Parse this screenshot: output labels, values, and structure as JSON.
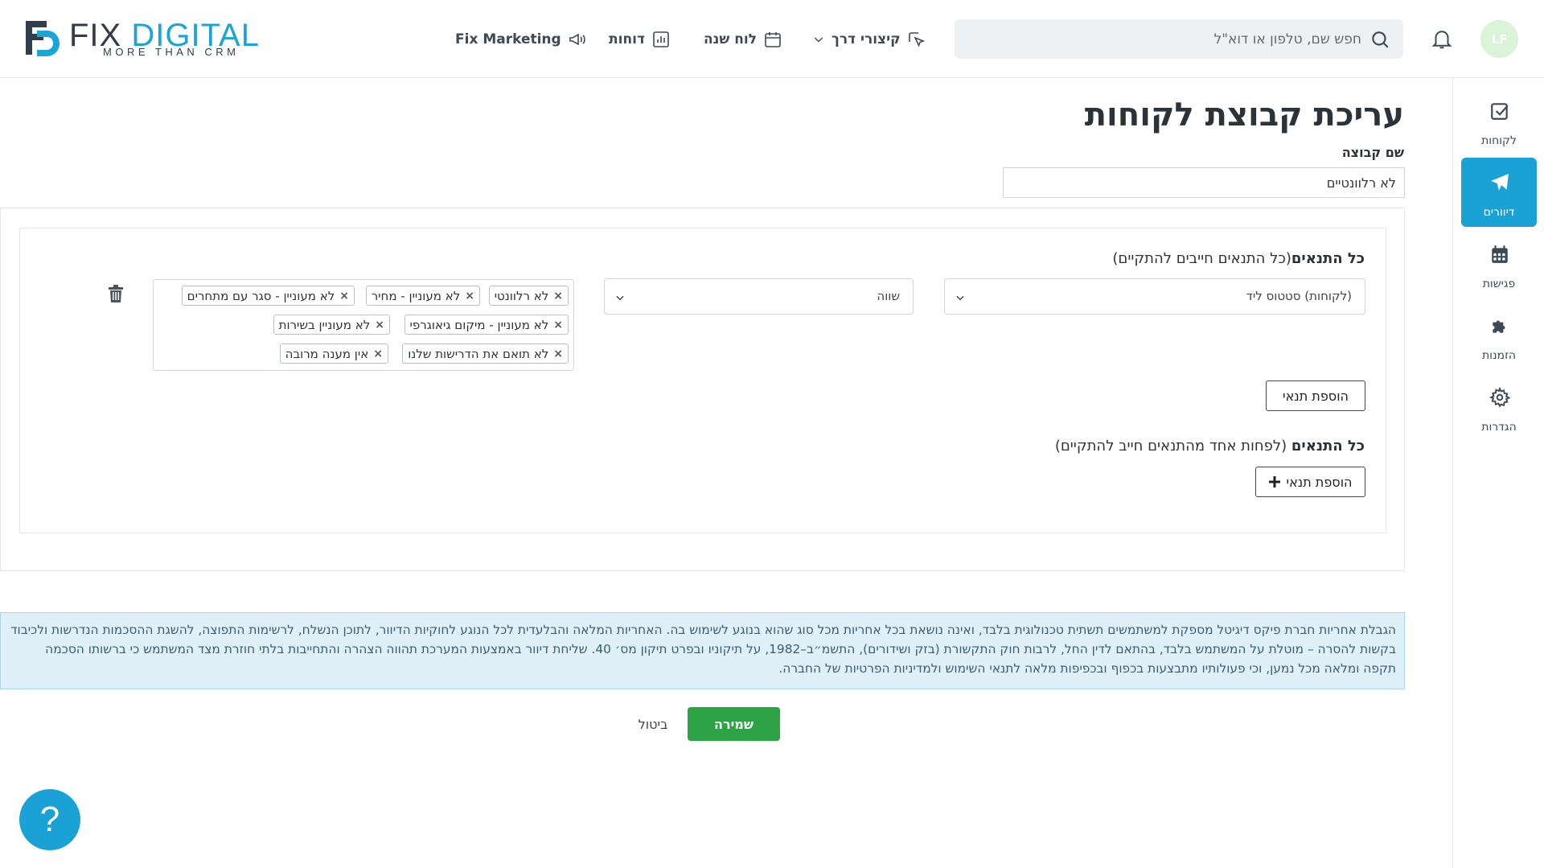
{
  "header": {
    "logo": {
      "fix": "FIX",
      "digital": "DIGITAL",
      "tagline": "MORE THAN CRM"
    },
    "nav": {
      "shortcuts": "קיצורי דרך",
      "calendar": "לוח שנה",
      "reports": "דוחות",
      "marketing": "Fix Marketing"
    },
    "search": {
      "placeholder": "חפש שם, טלפון או דוא\"ל",
      "value": ""
    },
    "avatar": "LF"
  },
  "sidebar": {
    "items": [
      {
        "label": "לקוחות",
        "icon": "check-square-icon"
      },
      {
        "label": "דיוורים",
        "icon": "paper-plane-icon",
        "active": true
      },
      {
        "label": "פגישות",
        "icon": "calendar-icon"
      },
      {
        "label": "הזמנות",
        "icon": "puzzle-icon"
      },
      {
        "label": "הגדרות",
        "icon": "gear-icon"
      }
    ]
  },
  "page": {
    "title": "עריכת קבוצת לקוחות",
    "group_name_label": "שם קבוצה",
    "group_name_value": "לא רלוונטיים"
  },
  "conditions_all": {
    "title_bold": "כל התנאים",
    "title_note": "(כל התנאים חייבים להתקיים)",
    "field_select": "(לקוחות) סטטוס ליד",
    "operator_select": "שווה",
    "tags": [
      "לא רלוונטי",
      "לא מעוניין - מחיר",
      "לא מעוניין - סגר עם מתחרים",
      "לא מעוניין - מיקום גיאוגרפי",
      "לא מעוניין בשירות",
      "לא תואם את הדרישות שלנו",
      "אין מענה מרובה"
    ],
    "add_button": "הוספת תנאי"
  },
  "conditions_any": {
    "title_bold": "כל התנאים",
    "title_note": " (לפחות אחד מהתנאים חייב להתקיים)",
    "add_button": "הוספת תנאי"
  },
  "disclaimer": "הגבלת אחריות חברת פיקס דיגיטל מספקת למשתמשים תשתית טכנולוגית בלבד, ואינה נושאת בכל אחריות מכל סוג שהוא בנוגע לשימוש בה. האחריות המלאה והבלעדית לכל הנוגע לחוקיות הדיוור, לתוכן הנשלח, לרשימות התפוצה, להשגת ההסכמות הנדרשות ולכיבוד בקשות להסרה – מוטלת על המשתמש בלבד, בהתאם לדין החל, לרבות חוק התקשורת (בזק ושידורים), התשמ״ב–1982, על תיקוניו ובפרט תיקון מס׳ 40. שליחת דיוור באמצעות המערכת תהווה הצהרה והתחייבות בלתי חוזרת מצד המשתמש כי ברשותו הסכמה תקפה ומלאה מכל נמען, וכי פעולותיו מתבצעות בכפוף ובכפיפות מלאה לתנאי השימוש ולמדיניות הפרטיות של החברה.",
  "actions": {
    "save": "שמירה",
    "cancel": "ביטול"
  },
  "help": "?",
  "colors": {
    "accent": "#1aa1d5",
    "save": "#2ea345",
    "disclaimer_bg": "#dff0f9"
  }
}
